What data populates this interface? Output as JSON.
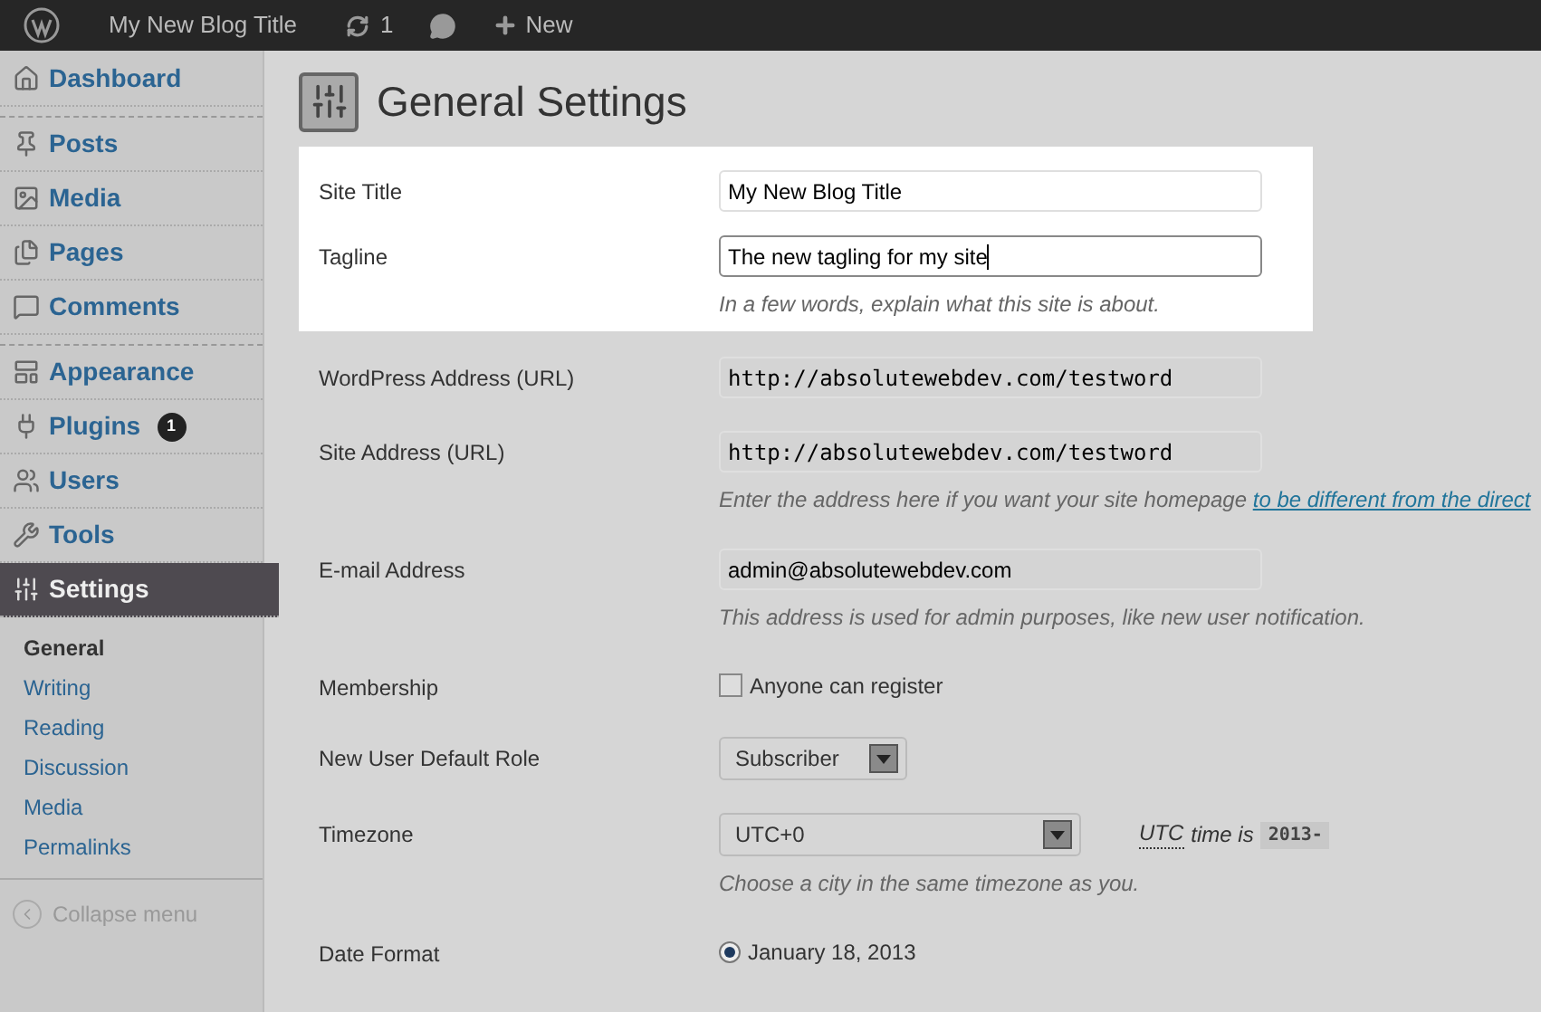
{
  "admin_bar": {
    "site_title": "My New Blog Title",
    "updates_count": "1",
    "new_label": "New"
  },
  "sidebar": {
    "groups": [
      [
        {
          "label": "Dashboard",
          "selected": false
        }
      ],
      [
        {
          "label": "Posts",
          "selected": false
        },
        {
          "label": "Media",
          "selected": false
        },
        {
          "label": "Pages",
          "selected": false
        },
        {
          "label": "Comments",
          "selected": false
        }
      ],
      [
        {
          "label": "Appearance",
          "selected": false
        },
        {
          "label": "Plugins",
          "selected": false,
          "badge": "1"
        },
        {
          "label": "Users",
          "selected": false
        },
        {
          "label": "Tools",
          "selected": false
        },
        {
          "label": "Settings",
          "selected": true
        }
      ]
    ],
    "submenu": [
      {
        "label": "General",
        "selected": true
      },
      {
        "label": "Writing",
        "selected": false
      },
      {
        "label": "Reading",
        "selected": false
      },
      {
        "label": "Discussion",
        "selected": false
      },
      {
        "label": "Media",
        "selected": false
      },
      {
        "label": "Permalinks",
        "selected": false
      }
    ],
    "collapse_label": "Collapse menu"
  },
  "page_title": "General Settings",
  "highlighted_fields": [
    {
      "kind": "text",
      "label": "Site Title",
      "value": "My New Blog Title",
      "focused": false
    },
    {
      "kind": "text",
      "label": "Tagline",
      "value": "The new tagling for my site",
      "focused": true,
      "description": "In a few words, explain what this site is about."
    }
  ],
  "fields": [
    {
      "kind": "code",
      "label": "WordPress Address (URL)",
      "value": "http://absolutewebdev.com/testword"
    },
    {
      "kind": "code",
      "label": "Site Address (URL)",
      "value": "http://absolutewebdev.com/testword",
      "description": "Enter the address here if you want your site homepage",
      "description_link": "to be different from the direct"
    },
    {
      "kind": "text",
      "label": "E-mail Address",
      "value": "admin@absolutewebdev.com",
      "description": "This address is used for admin purposes, like new user notification."
    },
    {
      "kind": "checkbox",
      "label": "Membership",
      "option": "Anyone can register",
      "checked": false
    },
    {
      "kind": "select",
      "label": "New User Default Role",
      "value": "Subscriber"
    },
    {
      "kind": "timezone",
      "label": "Timezone",
      "value": "UTC+0",
      "abbr": "UTC",
      "time_label": "time is",
      "time": "2013-",
      "description": "Choose a city in the same timezone as you."
    },
    {
      "kind": "radio",
      "label": "Date Format",
      "option": "January 18, 2013",
      "selected": true
    }
  ]
}
